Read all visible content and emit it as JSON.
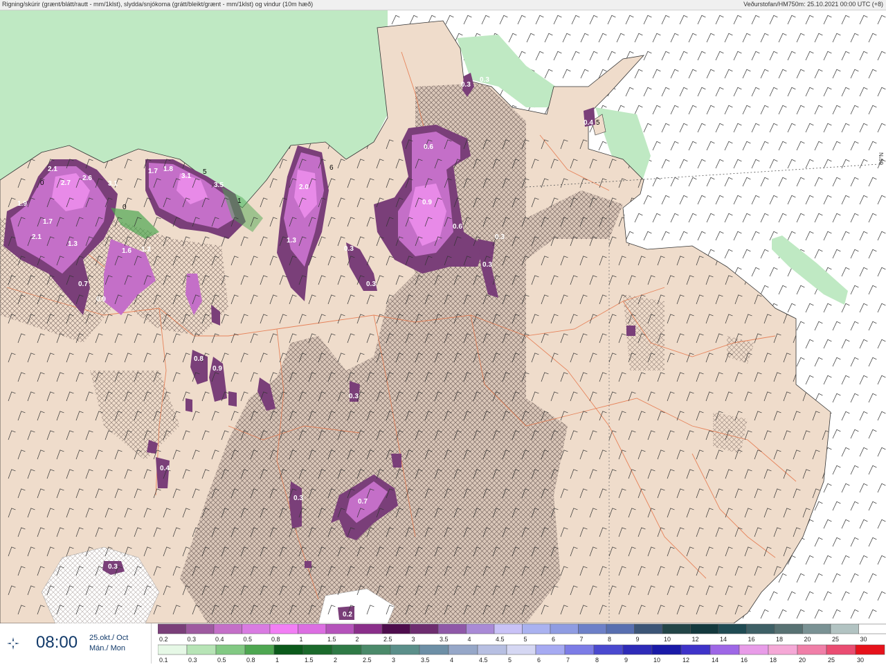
{
  "header": {
    "left_title": "Rigning/skúrir (grænt/blátt/rautt - mm/1klst), slydda/snjókoma (grátt/bleikt/grænt - mm/1klst) og vindur (10m hæð)",
    "right_title": "Veðurstofan/HM750m: 25.10.2021 00:00 UTC (+8)"
  },
  "time": {
    "clock": "08:00",
    "date_line": "25.okt./ Oct",
    "day_line": "Mán./ Mon"
  },
  "map": {
    "latitude_label": "66°N",
    "grid_mark_labels": [
      "0",
      "0",
      "5",
      "1",
      "6",
      "5"
    ],
    "precip_labels": [
      "2.1",
      "2.7",
      "2.6",
      "3.1",
      "1.9",
      "1.7",
      "2.1",
      "1.3",
      "0.7",
      "0.9",
      "1.6",
      "1.2",
      "1.7",
      "1.8",
      "3.1",
      "3.5",
      "2.0",
      "1.3",
      "0.3",
      "0.3",
      "0.6",
      "0.9",
      "0.6",
      "0.3",
      "0.3",
      "0.3",
      "0.4",
      "0.8",
      "0.9",
      "0.3",
      "0.3",
      "0.7",
      "0.3",
      "0.2",
      "0.4",
      "0.3"
    ],
    "colors": {
      "land": "#efdccb",
      "sea": "#ffffff",
      "rain_green": "#bfe9c3",
      "snow_purple": "#c55fc9",
      "roads": "#e67a4f"
    }
  },
  "legend": {
    "snow_scale": {
      "labels": [
        "0.2",
        "0.3",
        "0.4",
        "0.5",
        "0.8",
        "1",
        "1.5",
        "2",
        "2.5",
        "3",
        "3.5",
        "4",
        "4.5",
        "5",
        "6",
        "7",
        "8",
        "9",
        "10",
        "12",
        "14",
        "16",
        "18",
        "20",
        "25",
        "30"
      ],
      "colors": [
        "#7a3f79",
        "#9e5aa0",
        "#c46fc8",
        "#d97be2",
        "#f27ef5",
        "#dc6ee2",
        "#b553bb",
        "#8a2e8a",
        "#4e0d4d",
        "#6e2d70",
        "#8f58a8",
        "#a98ad6",
        "#c9c2f7",
        "#aab2f0",
        "#8f9ce2",
        "#6d80c8",
        "#586fb0",
        "#3c5576",
        "#234547",
        "#14393d",
        "#1f4b53",
        "#3e6066",
        "#587273",
        "#7a9294",
        "#b2c3c2",
        "#ffffff"
      ]
    },
    "rain_scale": {
      "labels": [
        "0.1",
        "0.3",
        "0.5",
        "0.8",
        "1",
        "1.5",
        "2",
        "2.5",
        "3",
        "3.5",
        "4",
        "4.5",
        "5",
        "6",
        "7",
        "8",
        "9",
        "10",
        "12",
        "14",
        "16",
        "18",
        "20",
        "25",
        "30"
      ],
      "colors": [
        "#e6f8e6",
        "#b7e4b6",
        "#82c983",
        "#4ea751",
        "#0b5a1b",
        "#1b6a2c",
        "#2f7a46",
        "#4b8a6a",
        "#5b8f8a",
        "#6d8fa6",
        "#96a7c8",
        "#b7bfe2",
        "#d5d7f3",
        "#a6aaf2",
        "#7c7ce6",
        "#4a49cf",
        "#2e2bb8",
        "#1a1aa8",
        "#3f33c9",
        "#9e67e6",
        "#e89ce8",
        "#f5a8d6",
        "#f07fa8",
        "#ea4d72",
        "#e6121b"
      ]
    }
  }
}
